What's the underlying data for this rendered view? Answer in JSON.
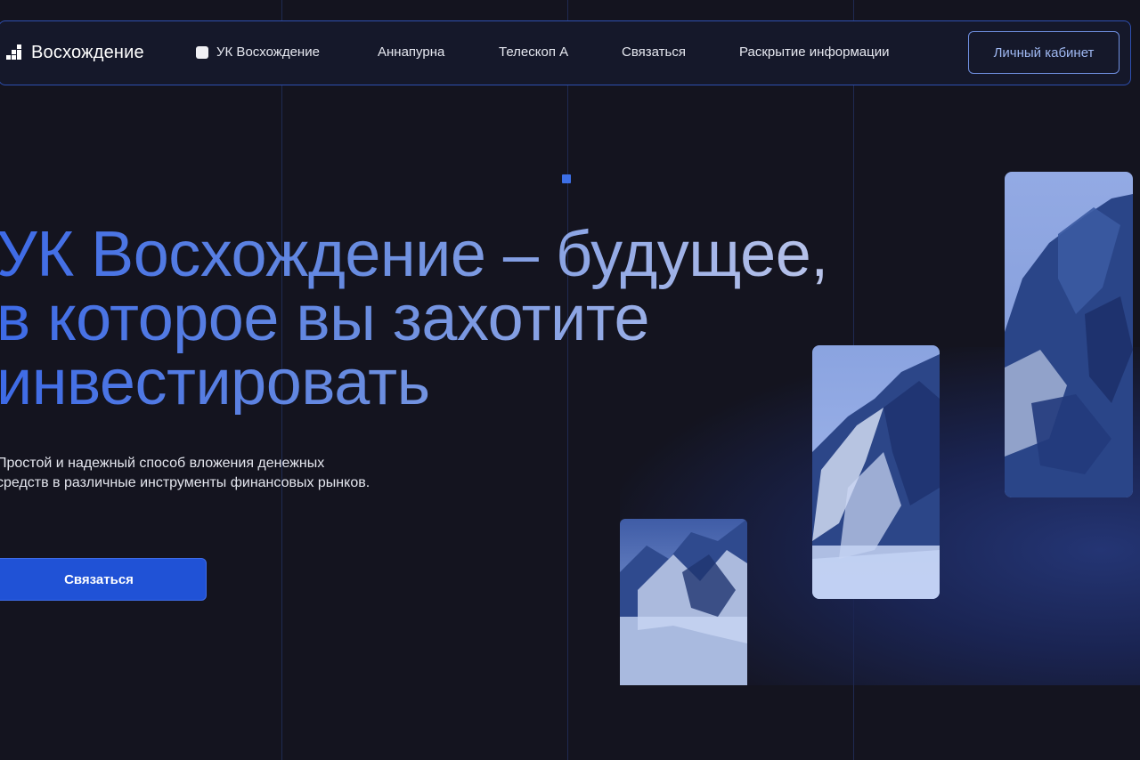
{
  "brand": {
    "name": "Восхождение"
  },
  "nav": {
    "items": [
      "УК Восхождение",
      "Аннапурна",
      "Телескоп А",
      "Связаться",
      "Раскрытие информации"
    ],
    "cabinet_label": "Личный кабинет"
  },
  "hero": {
    "headline_lines": [
      "УК Восхождение – будущее,",
      "в которое вы захотите",
      "инвестировать"
    ],
    "subtext_lines": [
      "Простой и надежный способ вложения денежных",
      "средств в различные инструменты финансовых рынков."
    ],
    "cta_label": "Связаться"
  },
  "icons": {
    "logo": "ascending-steps-logo-icon",
    "nav_chip": "square-chip-icon"
  },
  "colors": {
    "background": "#14141f",
    "accent": "#2052d6",
    "nav_border": "#2e4fb0",
    "cabinet_text": "#9fb8f2"
  },
  "images": [
    {
      "name": "mountain-image-small",
      "alt": "mountain cliffs in mist"
    },
    {
      "name": "mountain-image-medium",
      "alt": "mountain cliffs in mist"
    },
    {
      "name": "mountain-image-tall",
      "alt": "mountain cliffs in mist"
    }
  ]
}
